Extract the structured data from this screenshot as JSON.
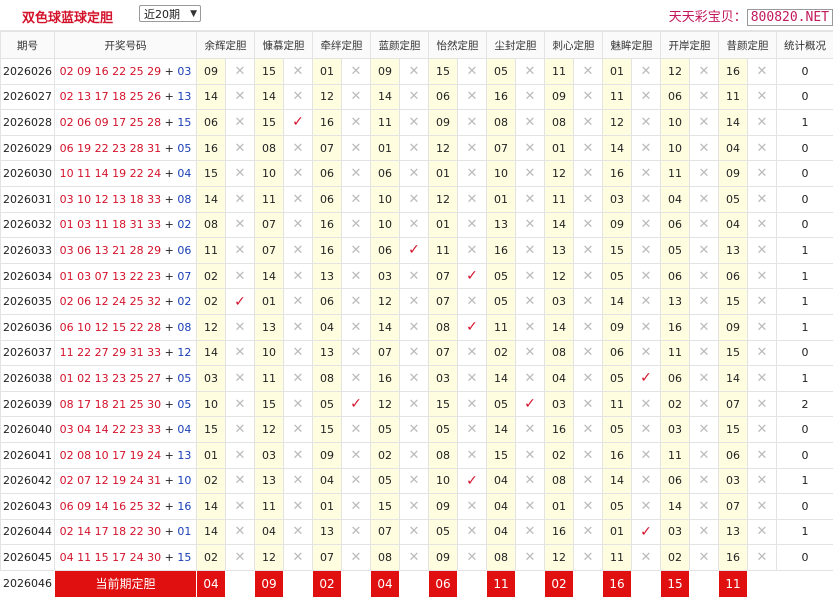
{
  "header": {
    "title": "双色球蓝球定胆",
    "period_select": "近20期",
    "brand_text": "天天彩宝贝：",
    "brand_domain": "800820.NET"
  },
  "columns": {
    "period": "期号",
    "numbers": "开奖号码",
    "experts": [
      "余辉定胆",
      "慷慕定胆",
      "牵绊定胆",
      "蓝颜定胆",
      "怡然定胆",
      "尘封定胆",
      "刺心定胆",
      "魅眸定胆",
      "开岸定胆",
      "昔颜定胆"
    ],
    "stats": "统计概况"
  },
  "rows": [
    {
      "period": "2026026",
      "red": "02 09 16 22 25 29",
      "blue": "03",
      "picks": [
        "09",
        "15",
        "01",
        "09",
        "15",
        "05",
        "11",
        "01",
        "12",
        "16"
      ],
      "hits": [
        0,
        0,
        0,
        0,
        0,
        0,
        0,
        0,
        0,
        0
      ],
      "count": "0"
    },
    {
      "period": "2026027",
      "red": "02 13 17 18 25 26",
      "blue": "13",
      "picks": [
        "14",
        "14",
        "12",
        "14",
        "06",
        "16",
        "09",
        "11",
        "06",
        "11"
      ],
      "hits": [
        0,
        0,
        0,
        0,
        0,
        0,
        0,
        0,
        0,
        0
      ],
      "count": "0"
    },
    {
      "period": "2026028",
      "red": "02 06 09 17 25 28",
      "blue": "15",
      "picks": [
        "06",
        "15",
        "16",
        "11",
        "09",
        "08",
        "08",
        "12",
        "10",
        "14"
      ],
      "hits": [
        0,
        1,
        0,
        0,
        0,
        0,
        0,
        0,
        0,
        0
      ],
      "count": "1"
    },
    {
      "period": "2026029",
      "red": "06 19 22 23 28 31",
      "blue": "05",
      "picks": [
        "16",
        "08",
        "07",
        "01",
        "12",
        "07",
        "01",
        "14",
        "10",
        "04"
      ],
      "hits": [
        0,
        0,
        0,
        0,
        0,
        0,
        0,
        0,
        0,
        0
      ],
      "count": "0"
    },
    {
      "period": "2026030",
      "red": "10 11 14 19 22 24",
      "blue": "04",
      "picks": [
        "15",
        "10",
        "06",
        "06",
        "01",
        "10",
        "12",
        "16",
        "11",
        "09"
      ],
      "hits": [
        0,
        0,
        0,
        0,
        0,
        0,
        0,
        0,
        0,
        0
      ],
      "count": "0"
    },
    {
      "period": "2026031",
      "red": "03 10 12 13 18 33",
      "blue": "08",
      "picks": [
        "14",
        "11",
        "06",
        "10",
        "12",
        "01",
        "11",
        "03",
        "04",
        "05"
      ],
      "hits": [
        0,
        0,
        0,
        0,
        0,
        0,
        0,
        0,
        0,
        0
      ],
      "count": "0"
    },
    {
      "period": "2026032",
      "red": "01 03 11 18 31 33",
      "blue": "02",
      "picks": [
        "08",
        "07",
        "16",
        "10",
        "01",
        "13",
        "14",
        "09",
        "06",
        "04"
      ],
      "hits": [
        0,
        0,
        0,
        0,
        0,
        0,
        0,
        0,
        0,
        0
      ],
      "count": "0"
    },
    {
      "period": "2026033",
      "red": "03 06 13 21 28 29",
      "blue": "06",
      "picks": [
        "11",
        "07",
        "16",
        "06",
        "11",
        "16",
        "13",
        "15",
        "05",
        "13"
      ],
      "hits": [
        0,
        0,
        0,
        1,
        0,
        0,
        0,
        0,
        0,
        0
      ],
      "count": "1"
    },
    {
      "period": "2026034",
      "red": "01 03 07 13 22 23",
      "blue": "07",
      "picks": [
        "02",
        "14",
        "13",
        "03",
        "07",
        "05",
        "12",
        "05",
        "06",
        "06"
      ],
      "hits": [
        0,
        0,
        0,
        0,
        1,
        0,
        0,
        0,
        0,
        0
      ],
      "count": "1"
    },
    {
      "period": "2026035",
      "red": "02 06 12 24 25 32",
      "blue": "02",
      "picks": [
        "02",
        "01",
        "06",
        "12",
        "07",
        "05",
        "03",
        "14",
        "13",
        "15"
      ],
      "hits": [
        1,
        0,
        0,
        0,
        0,
        0,
        0,
        0,
        0,
        0
      ],
      "count": "1"
    },
    {
      "period": "2026036",
      "red": "06 10 12 15 22 28",
      "blue": "08",
      "picks": [
        "12",
        "13",
        "04",
        "14",
        "08",
        "11",
        "14",
        "09",
        "16",
        "09"
      ],
      "hits": [
        0,
        0,
        0,
        0,
        1,
        0,
        0,
        0,
        0,
        0
      ],
      "count": "1"
    },
    {
      "period": "2026037",
      "red": "11 22 27 29 31 33",
      "blue": "12",
      "picks": [
        "14",
        "10",
        "13",
        "07",
        "07",
        "02",
        "08",
        "06",
        "11",
        "15"
      ],
      "hits": [
        0,
        0,
        0,
        0,
        0,
        0,
        0,
        0,
        0,
        0
      ],
      "count": "0"
    },
    {
      "period": "2026038",
      "red": "01 02 13 23 25 27",
      "blue": "05",
      "picks": [
        "03",
        "11",
        "08",
        "16",
        "03",
        "14",
        "04",
        "05",
        "06",
        "14"
      ],
      "hits": [
        0,
        0,
        0,
        0,
        0,
        0,
        0,
        1,
        0,
        0
      ],
      "count": "1"
    },
    {
      "period": "2026039",
      "red": "08 17 18 21 25 30",
      "blue": "05",
      "picks": [
        "10",
        "15",
        "05",
        "12",
        "15",
        "05",
        "03",
        "11",
        "02",
        "07"
      ],
      "hits": [
        0,
        0,
        1,
        0,
        0,
        1,
        0,
        0,
        0,
        0
      ],
      "count": "2"
    },
    {
      "period": "2026040",
      "red": "03 04 14 22 23 33",
      "blue": "04",
      "picks": [
        "15",
        "12",
        "15",
        "05",
        "05",
        "14",
        "16",
        "05",
        "03",
        "15"
      ],
      "hits": [
        0,
        0,
        0,
        0,
        0,
        0,
        0,
        0,
        0,
        0
      ],
      "count": "0"
    },
    {
      "period": "2026041",
      "red": "02 08 10 17 19 24",
      "blue": "13",
      "picks": [
        "01",
        "03",
        "09",
        "02",
        "08",
        "15",
        "02",
        "16",
        "11",
        "06"
      ],
      "hits": [
        0,
        0,
        0,
        0,
        0,
        0,
        0,
        0,
        0,
        0
      ],
      "count": "0"
    },
    {
      "period": "2026042",
      "red": "02 07 12 19 24 31",
      "blue": "10",
      "picks": [
        "02",
        "13",
        "04",
        "05",
        "10",
        "04",
        "08",
        "14",
        "06",
        "03"
      ],
      "hits": [
        0,
        0,
        0,
        0,
        1,
        0,
        0,
        0,
        0,
        0
      ],
      "count": "1"
    },
    {
      "period": "2026043",
      "red": "06 09 14 16 25 32",
      "blue": "16",
      "picks": [
        "14",
        "11",
        "01",
        "15",
        "09",
        "04",
        "01",
        "05",
        "14",
        "07"
      ],
      "hits": [
        0,
        0,
        0,
        0,
        0,
        0,
        0,
        0,
        0,
        0
      ],
      "count": "0"
    },
    {
      "period": "2026044",
      "red": "02 14 17 18 22 30",
      "blue": "01",
      "picks": [
        "14",
        "04",
        "13",
        "07",
        "05",
        "04",
        "16",
        "01",
        "03",
        "13"
      ],
      "hits": [
        0,
        0,
        0,
        0,
        0,
        0,
        0,
        1,
        0,
        0
      ],
      "count": "1"
    },
    {
      "period": "2026045",
      "red": "04 11 15 17 24 30",
      "blue": "15",
      "picks": [
        "02",
        "12",
        "07",
        "08",
        "09",
        "08",
        "12",
        "11",
        "02",
        "16"
      ],
      "hits": [
        0,
        0,
        0,
        0,
        0,
        0,
        0,
        0,
        0,
        0
      ],
      "count": "0"
    }
  ],
  "current": {
    "period": "2026046",
    "label": "当前期定胆",
    "picks": [
      "04",
      "09",
      "02",
      "04",
      "06",
      "11",
      "02",
      "16",
      "15",
      "11"
    ]
  },
  "symbols": {
    "miss": "✕",
    "hit": "✓",
    "plus": "+",
    "arrow": "▼"
  },
  "colors": {
    "red": "#d4122b",
    "blue": "#1a3fb5",
    "highlight": "#fffde0",
    "current_bg": "#e01010"
  }
}
